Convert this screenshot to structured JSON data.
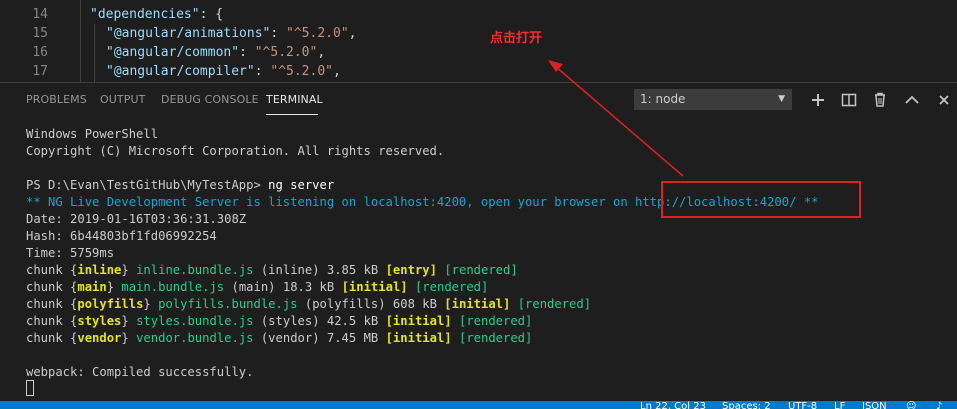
{
  "editor": {
    "lines": [
      {
        "num": "14",
        "key": "\"dependencies\"",
        "rest": ": {"
      },
      {
        "num": "15",
        "key": "\"@angular/animations\"",
        "colon": ": ",
        "val": "\"^5.2.0\"",
        "rest": ","
      },
      {
        "num": "16",
        "key": "\"@angular/common\"",
        "colon": ": ",
        "val": "\"^5.2.0\"",
        "rest": ","
      },
      {
        "num": "17",
        "key": "\"@angular/compiler\"",
        "colon": ": ",
        "val": "\"^5.2.0\"",
        "rest": ","
      }
    ]
  },
  "panel": {
    "tabs": [
      "PROBLEMS",
      "OUTPUT",
      "DEBUG CONSOLE",
      "TERMINAL"
    ],
    "active_tab": "TERMINAL",
    "terminal_select": "1: node",
    "icons": [
      "plus-icon",
      "split-icon",
      "trash-icon",
      "chevron-up-icon",
      "close-icon"
    ]
  },
  "terminal": {
    "line1": "Windows PowerShell",
    "line2": "Copyright (C) Microsoft Corporation. All rights reserved.",
    "prompt": "PS D:\\Evan\\TestGitHub\\MyTestApp> ",
    "command": "ng server",
    "ng_live": "** NG Live Development Server is listening on localhost:4200, open your browser on http://localhost:4200/ **",
    "date": "Date: 2019-01-16T03:36:31.308Z",
    "hash": "Hash: 6b44803bf1fd06992254",
    "time": "Time: 5759ms",
    "chunks": [
      {
        "name": "inline",
        "file": "inline.bundle.js",
        "info": "(inline) 3.85 kB",
        "tag": "[entry]",
        "status": "[rendered]"
      },
      {
        "name": "main",
        "file": "main.bundle.js",
        "info": "(main) 18.3 kB",
        "tag": "[initial]",
        "status": "[rendered]"
      },
      {
        "name": "polyfills",
        "file": "polyfills.bundle.js",
        "info": "(polyfills) 608 kB",
        "tag": "[initial]",
        "status": "[rendered]"
      },
      {
        "name": "styles",
        "file": "styles.bundle.js",
        "info": "(styles) 42.5 kB",
        "tag": "[initial]",
        "status": "[rendered]"
      },
      {
        "name": "vendor",
        "file": "vendor.bundle.js",
        "info": "(vendor) 7.45 MB",
        "tag": "[initial]",
        "status": "[rendered]"
      }
    ],
    "chunk_word": "chunk",
    "webpack": "webpack: Compiled successfully."
  },
  "annotation": {
    "text": "点击打开",
    "color": "#e02020"
  },
  "statusbar": {
    "position": "Ln 22, Col 23",
    "spaces": "Spaces: 2",
    "encoding": "UTF-8",
    "eol": "LF",
    "language": "JSON",
    "color": "#007acc"
  }
}
